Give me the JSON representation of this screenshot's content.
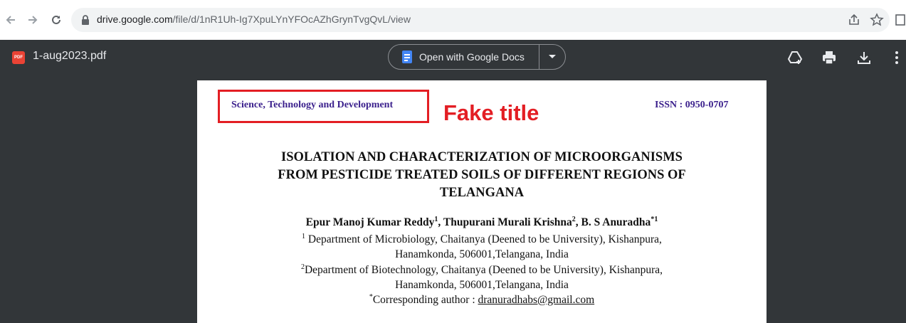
{
  "browser": {
    "url_host": "drive.google.com",
    "url_path": "/file/d/1nR1Uh-Ig7XpuLYnYFOcAZhGrynTvgQvL/view"
  },
  "viewer": {
    "file_name": "1-aug2023.pdf",
    "file_badge": "PDF",
    "open_with_label": "Open with Google Docs",
    "icons": [
      "add-to-drive-icon",
      "print-icon",
      "download-icon",
      "more-vert-icon"
    ]
  },
  "document": {
    "journal_name": "Science, Technology and Development",
    "issn": "ISSN : 0950-0707",
    "annotation": "Fake title",
    "title_line1": "ISOLATION AND CHARACTERIZATION OF MICROORGANISMS",
    "title_line2": "FROM PESTICIDE TREATED SOILS OF DIFFERENT REGIONS OF",
    "title_line3": "TELANGANA",
    "author1": "Epur Manoj Kumar Reddy",
    "author1_sup": "1",
    "author_sep1": ", ",
    "author2": "Thupurani Murali Krishna",
    "author2_sup": "2",
    "author_sep2": ", ",
    "author3": "B. S Anuradha",
    "author3_sup": "*1",
    "affil1_sup": "1",
    "affil1_line1": " Department of Microbiology, Chaitanya (Deened to be University), Kishanpura,",
    "affil1_line2": "Hanamkonda,  506001,Telangana, India",
    "affil2_sup": "2",
    "affil2_line1": "Department of Biotechnology, Chaitanya (Deened to be University), Kishanpura,",
    "affil2_line2": "Hanamkonda,  506001,Telangana, India",
    "corr_sup": "*",
    "corr_label": "Corresponding author : ",
    "corr_email": "dranuradhabs@gmail.com"
  },
  "colors": {
    "journal_text": "#3a1f8c",
    "annotation_red": "#e31e24",
    "viewer_bg": "#323639"
  }
}
